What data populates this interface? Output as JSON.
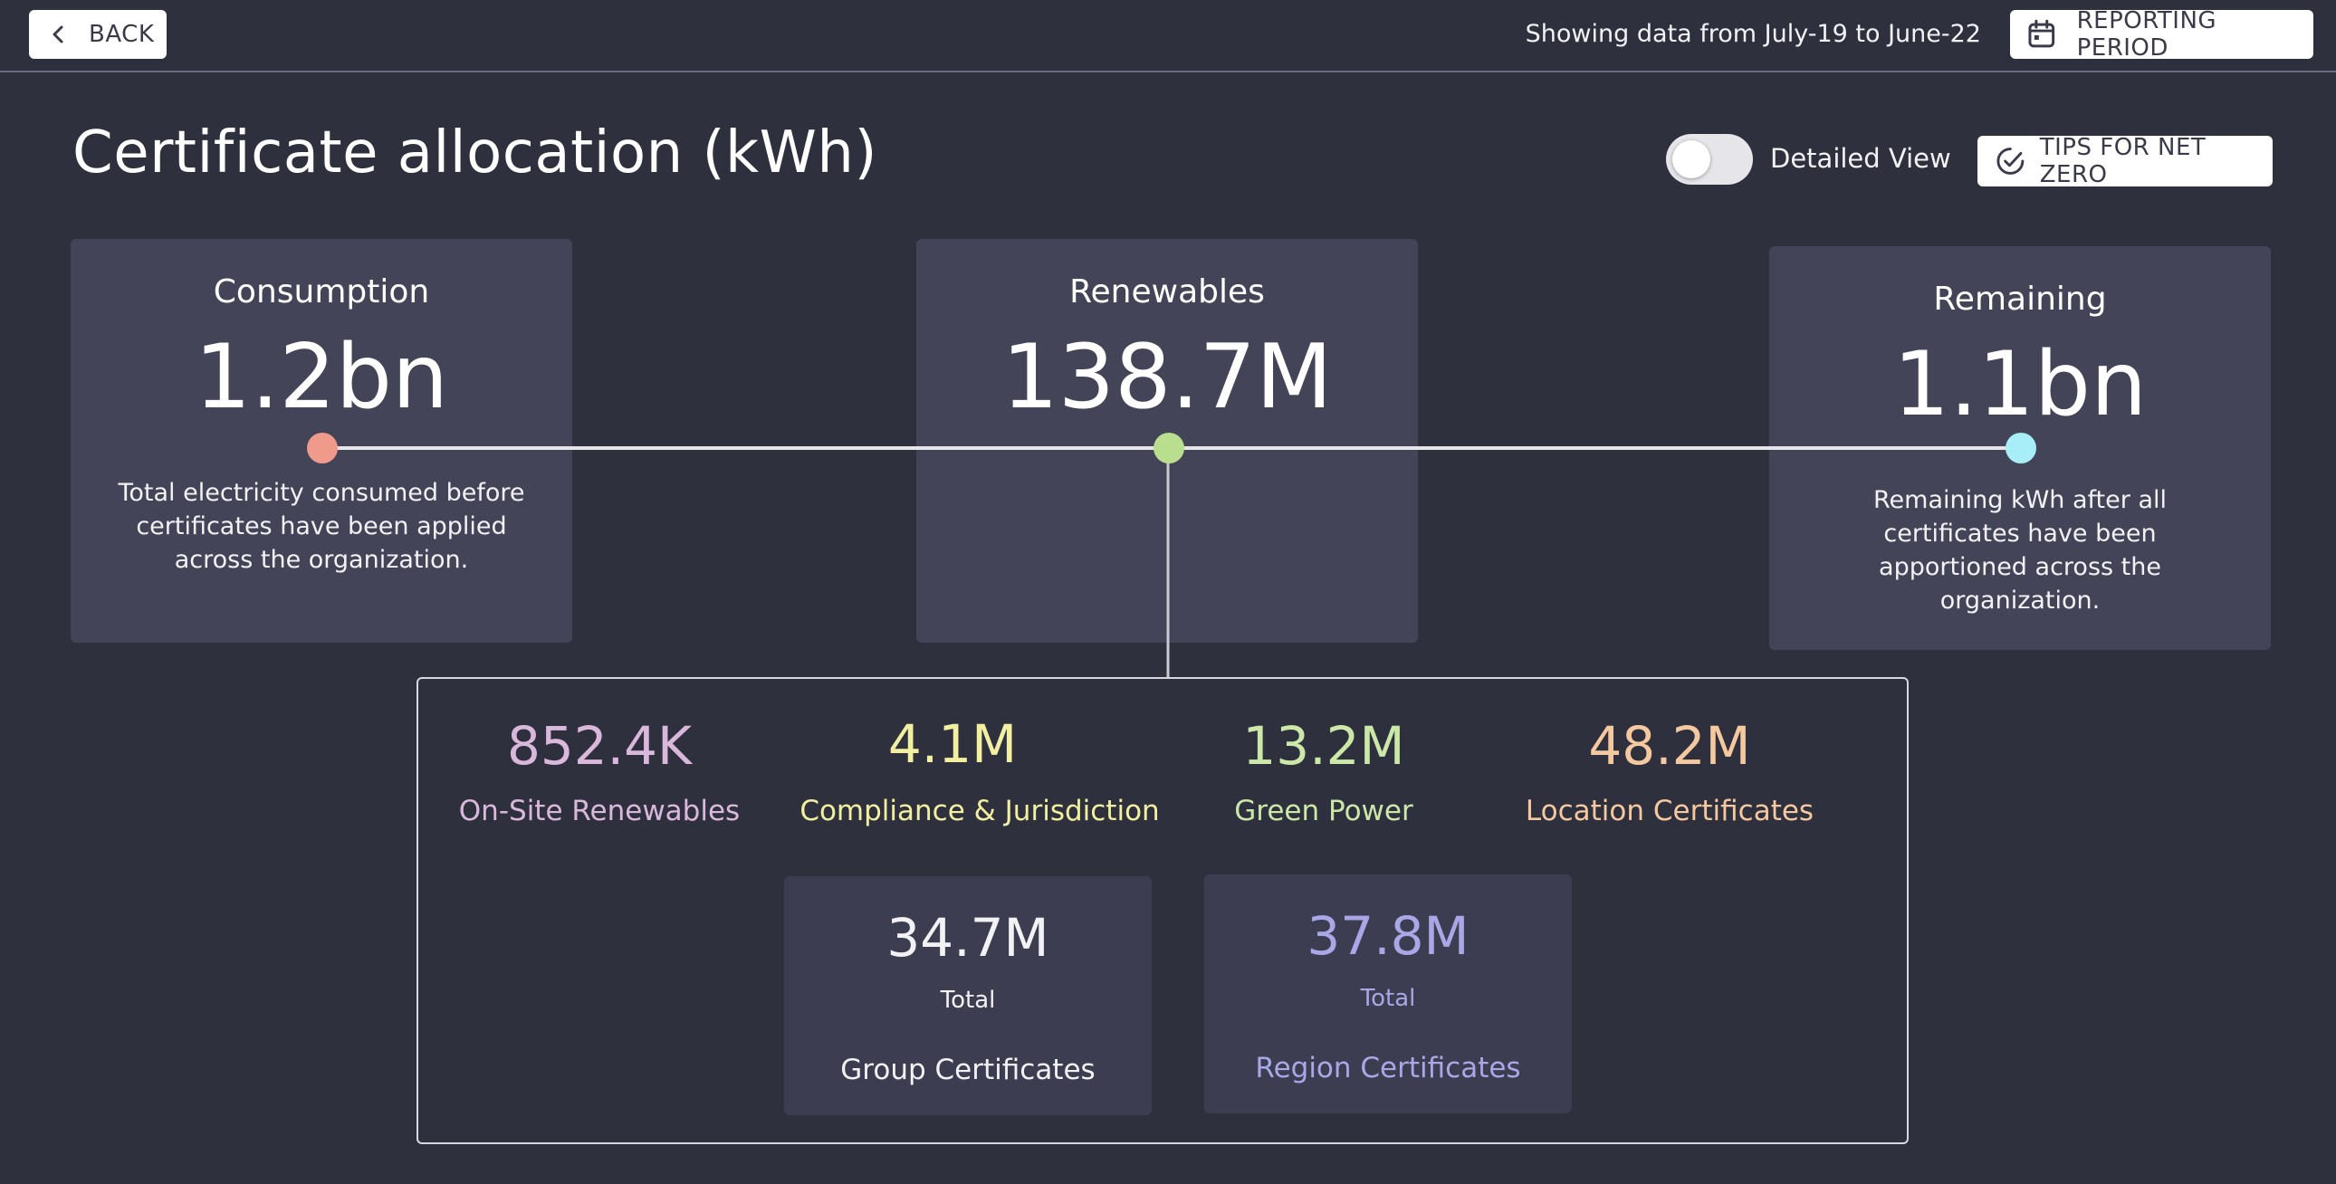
{
  "header": {
    "back_label": "BACK",
    "period_text": "Showing data from July-19 to June-22",
    "period_button_label": "REPORTING PERIOD"
  },
  "page": {
    "title": "Certificate allocation (kWh)",
    "toggle_label": "Detailed View",
    "toggle_on": false,
    "tips_button_label": "TIPS FOR NET ZERO"
  },
  "summary": {
    "consumption": {
      "label": "Consumption",
      "value": "1.2bn",
      "description": "Total electricity consumed before certificates have been applied across the organization.",
      "dot_color": "#f09a8c"
    },
    "renewables": {
      "label": "Renewables",
      "value": "138.7M",
      "dot_color": "#b9df8e"
    },
    "remaining": {
      "label": "Remaining",
      "value": "1.1bn",
      "description": "Remaining kWh after all certificates have been apportioned across the organization.",
      "dot_color": "#a8eef8"
    }
  },
  "breakdown": {
    "onsite": {
      "value": "852.4K",
      "label": "On-Site Renewables",
      "color": "#d9b8dc"
    },
    "compliance": {
      "value": "4.1M",
      "label": "Compliance & Jurisdiction",
      "color": "#f2f0a0"
    },
    "green_power": {
      "value": "13.2M",
      "label": "Green Power",
      "color": "#cce8a8"
    },
    "location": {
      "value": "48.2M",
      "label": "Location Certificates",
      "color": "#f5c9a0"
    },
    "group": {
      "value": "34.7M",
      "total_label": "Total",
      "label": "Group Certificates",
      "color": "#f2f2f4"
    },
    "region": {
      "value": "37.8M",
      "total_label": "Total",
      "label": "Region Certificates",
      "color": "#a9a7e6"
    }
  },
  "icons": {
    "back": "chevron-left-icon",
    "period": "calendar-icon",
    "tips": "checkmark-circle-icon"
  }
}
